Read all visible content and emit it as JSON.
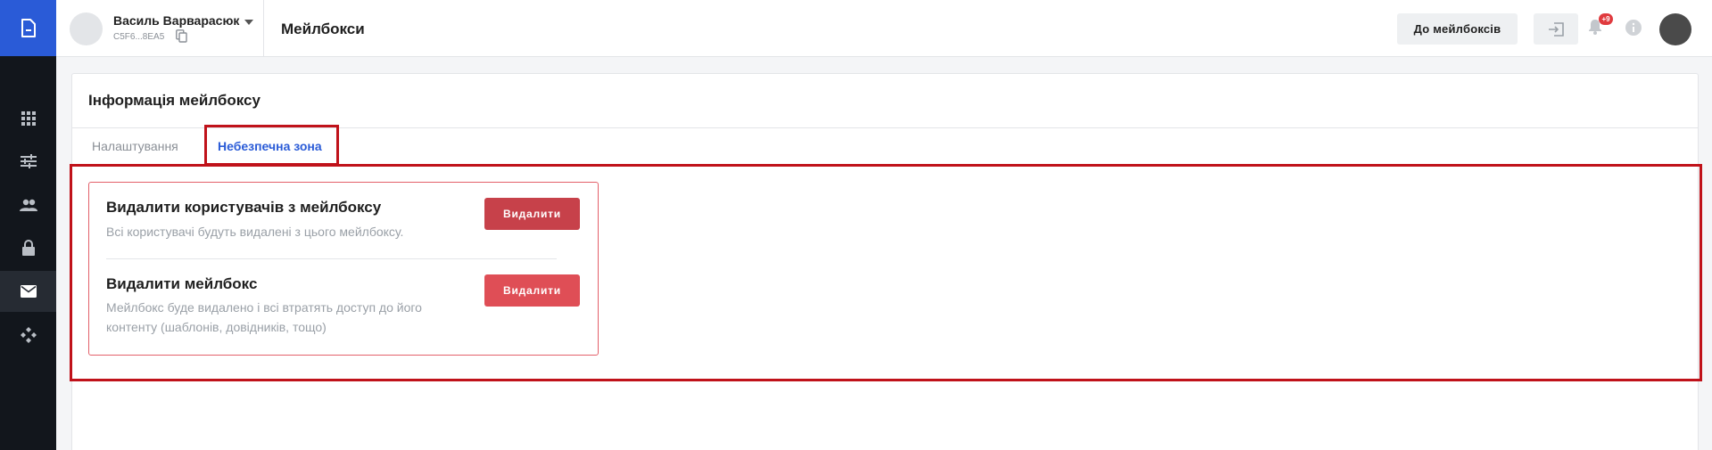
{
  "sidebar": {
    "logo_icon": "document-logo-icon",
    "items": [
      {
        "icon": "apps-grid-icon",
        "active": false
      },
      {
        "icon": "sliders-icon",
        "active": false
      },
      {
        "icon": "users-icon",
        "active": false
      },
      {
        "icon": "lock-icon",
        "active": false
      },
      {
        "icon": "mail-icon",
        "active": true
      },
      {
        "icon": "diamond-arrows-icon",
        "active": false
      }
    ],
    "bg_color": "#12161c",
    "logo_color": "#2a5bd7"
  },
  "header": {
    "user_name": "Василь Варварасюк",
    "user_id": "C5F6...8EA5",
    "page_title": "Мейлбокси",
    "to_mailboxes_label": "До мейлбоксів",
    "notifications_badge": "+9"
  },
  "card": {
    "title": "Інформація мейлбоксу",
    "tabs": [
      {
        "label": "Налаштування",
        "active": false
      },
      {
        "label": "Небезпечна зона",
        "active": true
      }
    ]
  },
  "danger_zone": {
    "items": [
      {
        "title": "Видалити користувачів з мейлбоксу",
        "description": "Всі користувачі будуть видалені з цього мейлбоксу.",
        "button_label": "Видалити"
      },
      {
        "title": "Видалити мейлбокс",
        "description": "Мейлбокс буде видалено і всі втратять доступ до його контенту (шаблонів, довідників, тощо)",
        "button_label": "Видалити"
      }
    ],
    "border_color": "#e3606a",
    "button_color": "#df4e56"
  },
  "accent_color": "#2a5bd7",
  "highlight_color": "#c0121a"
}
